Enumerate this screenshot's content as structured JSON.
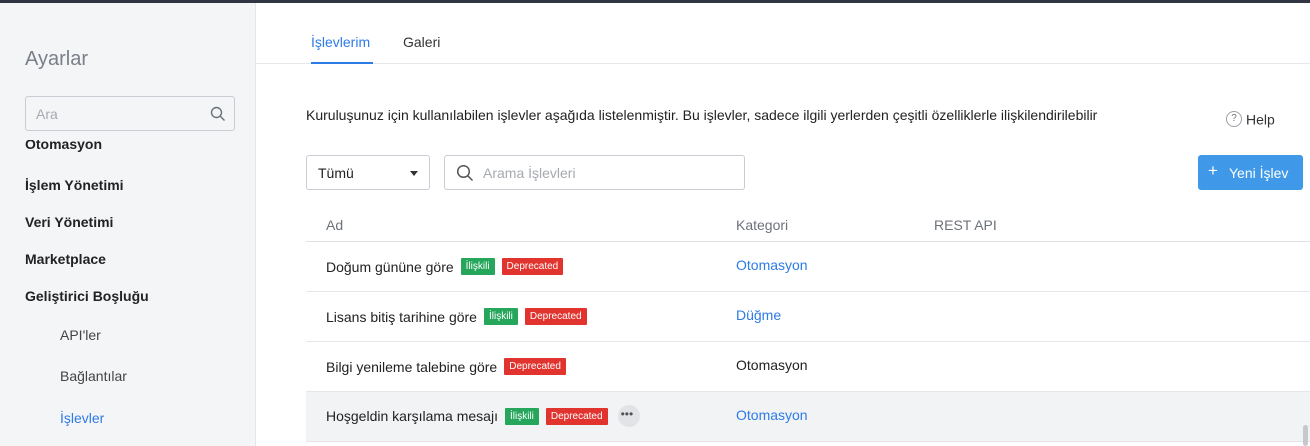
{
  "sidebar": {
    "title": "Ayarlar",
    "search_placeholder": "Ara",
    "partial_item": "Otomasyon",
    "items": [
      "İşlem Yönetimi",
      "Veri Yönetimi",
      "Marketplace",
      "Geliştirici Boşluğu"
    ],
    "sub_items": [
      "API'ler",
      "Bağlantılar",
      "İşlevler"
    ],
    "active_sub_item": "İşlevler"
  },
  "tabs": [
    "İşlevlerim",
    "Galeri"
  ],
  "active_tab": "İşlevlerim",
  "description": "Kuruluşunuz için kullanılabilen işlevler aşağıda listelenmiştir. Bu işlevler, sadece ilgili yerlerden çeşitli özelliklerle ilişkilendirilebilir",
  "help_label": "Help",
  "filter": {
    "selected": "Tümü"
  },
  "search": {
    "placeholder": "Arama İşlevleri"
  },
  "new_button": {
    "label": "Yeni İşlev"
  },
  "table": {
    "columns": [
      "Ad",
      "Kategori",
      "REST API"
    ],
    "rows": [
      {
        "name": "Doğum gününe göre",
        "badges": [
          "İlişkili",
          "Deprecated"
        ],
        "category": "Otomasyon",
        "rest_api": ""
      },
      {
        "name": "Lisans bitiş tarihine göre",
        "badges": [
          "İlişkili",
          "Deprecated"
        ],
        "category": "Düğme",
        "rest_api": ""
      },
      {
        "name": "Bilgi yenileme talebine göre",
        "badges": [
          "Deprecated"
        ],
        "category": "Otomasyon",
        "rest_api": ""
      },
      {
        "name": "Hoşgeldin karşılama mesajı",
        "badges": [
          "İlişkili",
          "Deprecated"
        ],
        "category": "Otomasyon",
        "rest_api": ""
      }
    ]
  },
  "colors": {
    "accent": "#2d7be5",
    "button": "#3f98e8",
    "badge_related": "#26a65b",
    "badge_deprecated": "#e2342f",
    "sidebar_bg": "#f4f5f7"
  },
  "icons": {
    "search": "search-icon",
    "dropdown": "chevron-down-icon",
    "help": "help-icon",
    "plus": "plus-icon",
    "more": "more-icon"
  }
}
